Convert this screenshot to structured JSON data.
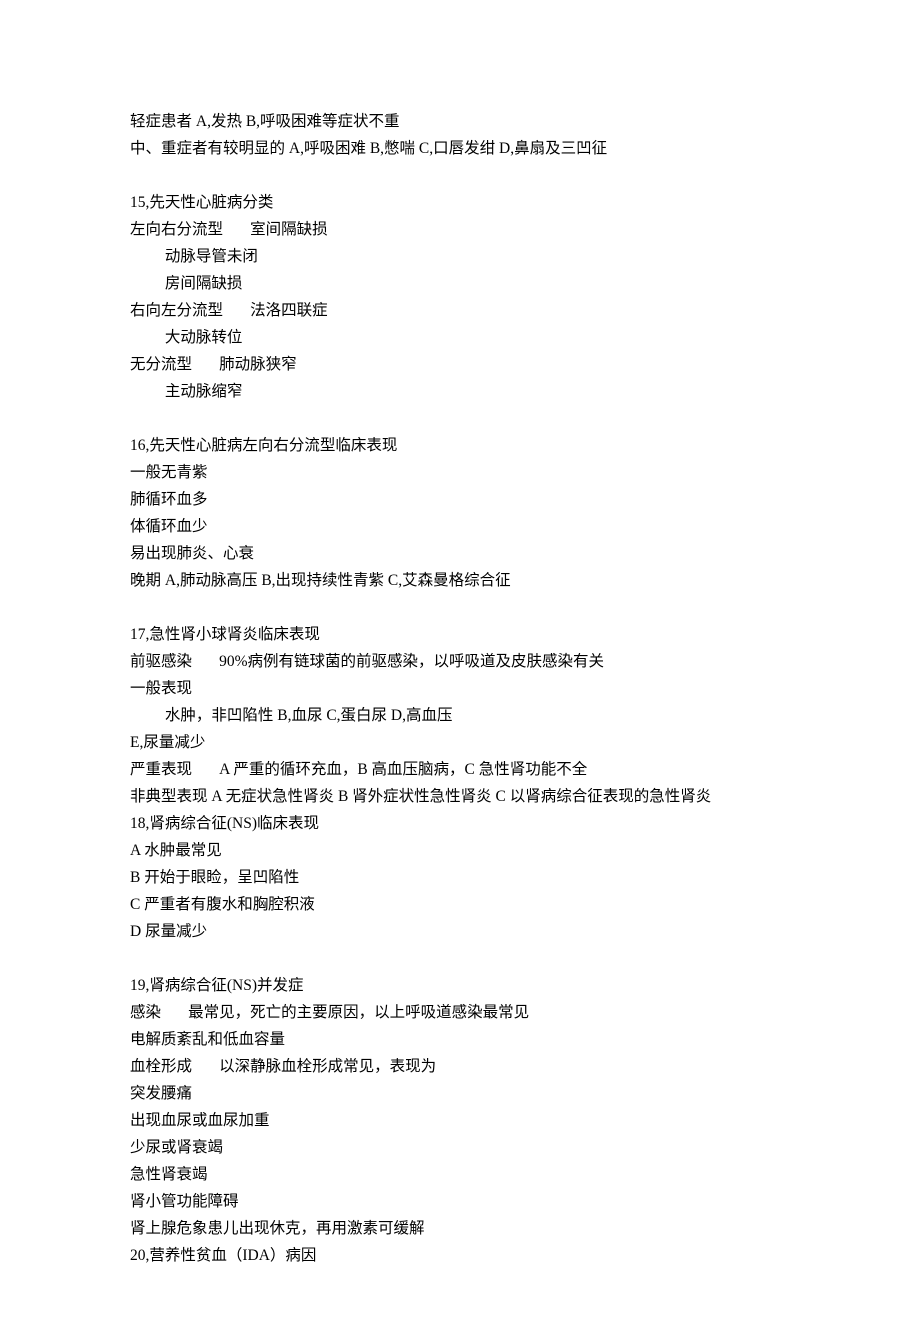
{
  "lines": [
    "轻症患者 A,发热 B,呼吸困难等症状不重",
    "中、重症者有较明显的 A,呼吸困难 B,憋喘 C,口唇发绀 D,鼻扇及三凹征",
    "",
    "15,先天性心脏病分类",
    "左向右分流型       室间隔缺损",
    "         动脉导管未闭",
    "         房间隔缺损",
    "右向左分流型       法洛四联症",
    "         大动脉转位",
    "无分流型       肺动脉狭窄",
    "         主动脉缩窄",
    "",
    "16,先天性心脏病左向右分流型临床表现",
    "一般无青紫",
    "肺循环血多",
    "体循环血少",
    "易出现肺炎、心衰",
    "晚期 A,肺动脉高压 B,出现持续性青紫 C,艾森曼格综合征",
    "",
    "17,急性肾小球肾炎临床表现",
    "前驱感染       90%病例有链球菌的前驱感染，以呼吸道及皮肤感染有关",
    "一般表现",
    "         水肿，非凹陷性 B,血尿 C,蛋白尿 D,高血压",
    "E,尿量减少",
    "严重表现       A 严重的循环充血，B 高血压脑病，C 急性肾功能不全",
    "非典型表现 A 无症状急性肾炎 B 肾外症状性急性肾炎 C 以肾病综合征表现的急性肾炎",
    "18,肾病综合征(NS)临床表现",
    "A 水肿最常见",
    "B 开始于眼睑，呈凹陷性",
    "C 严重者有腹水和胸腔积液",
    "D 尿量减少",
    "",
    "19,肾病综合征(NS)并发症",
    "感染       最常见，死亡的主要原因，以上呼吸道感染最常见",
    "电解质紊乱和低血容量",
    "血栓形成       以深静脉血栓形成常见，表现为",
    "突发腰痛",
    "出现血尿或血尿加重",
    "少尿或肾衰竭",
    "急性肾衰竭",
    "肾小管功能障碍",
    "肾上腺危象患儿出现休克，再用激素可缓解",
    "20,营养性贫血（IDA）病因"
  ]
}
